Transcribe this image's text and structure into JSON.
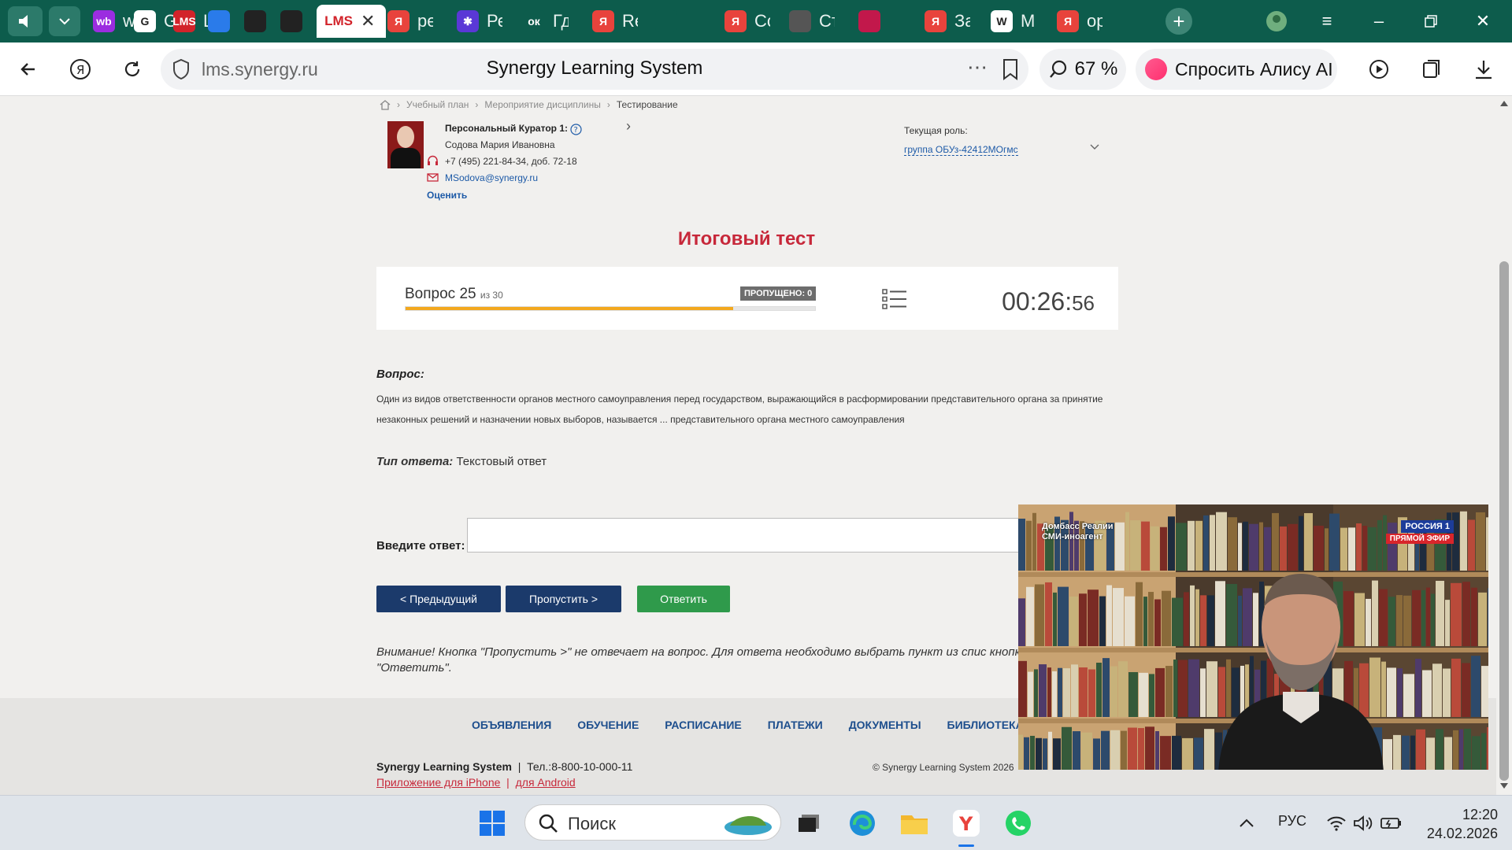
{
  "browser": {
    "tabs": [
      {
        "title": "wb",
        "fav_text": "wb",
        "color": "#9b2de0"
      },
      {
        "title": "G",
        "fav_text": "G",
        "color": "#ffffff"
      },
      {
        "title": "LMS",
        "fav_text": "LMS",
        "color": "#d2232a"
      },
      {
        "title": "",
        "fav_text": "",
        "color": "#2a7bea"
      },
      {
        "title": "",
        "fav_text": "",
        "color": "#222222"
      },
      {
        "title": "",
        "fav_text": "",
        "color": "#222222"
      },
      {
        "title": "LMS",
        "fav_text": "LMS",
        "color": "#d2232a"
      },
      {
        "title": "ре",
        "fav_text": "Я",
        "color": "#e8433c"
      },
      {
        "title": "Ре",
        "fav_text": "✱",
        "color": "#5a38d6"
      },
      {
        "title": "Гд",
        "fav_text": "ок",
        "color": "#0d5c4c"
      },
      {
        "title": "Re",
        "fav_text": "Я",
        "color": "#e8433c"
      },
      {
        "title": "",
        "fav_text": "",
        "color": "#0d5c4c"
      },
      {
        "title": "Сс",
        "fav_text": "Я",
        "color": "#e8433c"
      },
      {
        "title": "Ст",
        "fav_text": "",
        "color": "#555555"
      },
      {
        "title": "",
        "fav_text": "",
        "color": "#c2184b"
      },
      {
        "title": "За",
        "fav_text": "Я",
        "color": "#e8433c"
      },
      {
        "title": "М",
        "fav_text": "W",
        "color": "#ffffff"
      },
      {
        "title": "ор",
        "fav_text": "Я",
        "color": "#e8433c"
      }
    ],
    "url": "lms.synergy.ru",
    "page_title": "Synergy Learning System",
    "zoom": "67 %",
    "alice_label": "Спросить Алису AI"
  },
  "breadcrumbs": [
    "Учебный план",
    "Мероприятие дисциплины",
    "Тестирование"
  ],
  "curator": {
    "title": "Персональный Куратор 1:",
    "name": "Содова Мария Ивановна",
    "phone": "+7 (495) 221-84-34, доб. 72-18",
    "email": "MSodova@synergy.ru",
    "rate_label": "Оценить"
  },
  "role": {
    "label": "Текущая роль:",
    "value": "группа ОБУз-42412МОгмс"
  },
  "test": {
    "title": "Итоговый тест",
    "question_label": "Вопрос 25",
    "question_of": "из 30",
    "skipped": "ПРОПУЩЕНО: 0",
    "progress_fraction": 0.8,
    "timer_main": "00:26:",
    "timer_sec": "56"
  },
  "question": {
    "label": "Вопрос:",
    "text": "Один из видов ответственности органов местного самоуправления перед государством, выражающийся в расформировании представительного органа за принятие незаконных решений и назначении новых выборов, называется ... представительного органа местного самоуправления",
    "answer_type_label": "Тип ответа:",
    "answer_type_value": "Текстовый ответ",
    "answer_label": "Введите ответ:",
    "answer_value": ""
  },
  "buttons": {
    "prev": "< Предыдущий",
    "skip": "Пропустить >",
    "answer": "Ответить"
  },
  "warning": "Внимание! Кнопка \"Пропустить >\" не отвечает на вопрос. Для ответа необходимо выбрать пункт из спис кнопку \"Ответить\".",
  "footer": {
    "nav": [
      "ОБЪЯВЛЕНИЯ",
      "ОБУЧЕНИЕ",
      "РАСПИСАНИЕ",
      "ПЛАТЕЖИ",
      "ДОКУМЕНТЫ",
      "БИБЛИОТЕКА"
    ],
    "brand": "Synergy Learning System",
    "phone": "Тел.:8-800-10-000-11",
    "iphone": "Приложение для iPhone",
    "android": "для Android",
    "copyright": "© Synergy Learning System 2026"
  },
  "video": {
    "badge_left_1": "Домбасс Реалии",
    "badge_left_2": "СМИ-иноагент",
    "badge_right_1": "РОССИЯ 1",
    "badge_right_2": "ПРЯМОЙ ЭФИР"
  },
  "taskbar": {
    "search_placeholder": "Поиск",
    "lang": "РУС",
    "time": "12:20",
    "date": "24.02.2026"
  }
}
